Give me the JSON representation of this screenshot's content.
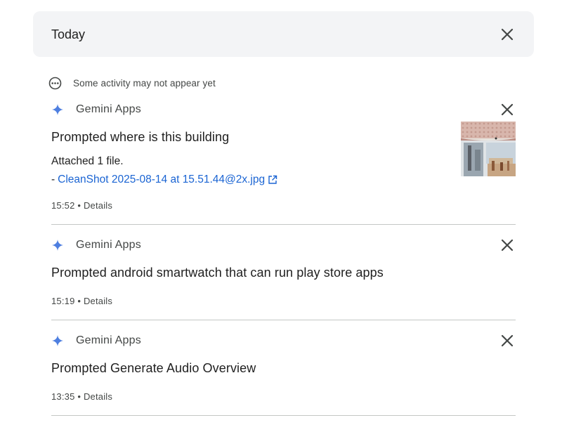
{
  "header": {
    "title": "Today",
    "close_icon": "close-icon"
  },
  "notice": {
    "icon": "more-horizontal-circle-icon",
    "text": "Some activity may not appear yet"
  },
  "entries": [
    {
      "source": "Gemini Apps",
      "source_icon": "gemini-sparkle-icon",
      "title": "Prompted where is this building",
      "attachment_text": "Attached 1 file.",
      "attachment_dash": "-",
      "attachment_file": "CleanShot 2025-08-14 at 15.51.44@2x.jpg",
      "attachment_icon": "open-in-new-icon",
      "time": "15:52",
      "separator": "•",
      "details": "Details",
      "has_thumbnail": true
    },
    {
      "source": "Gemini Apps",
      "source_icon": "gemini-sparkle-icon",
      "title": "Prompted android smartwatch that can run play store apps",
      "time": "15:19",
      "separator": "•",
      "details": "Details"
    },
    {
      "source": "Gemini Apps",
      "source_icon": "gemini-sparkle-icon",
      "title": "Prompted Generate Audio Overview",
      "time": "13:35",
      "separator": "•",
      "details": "Details"
    }
  ],
  "colors": {
    "accent_link": "#1a64d3",
    "sparkle": "#4e7fe0",
    "header_bg": "#f3f4f6",
    "divider": "#c4c7c5"
  }
}
